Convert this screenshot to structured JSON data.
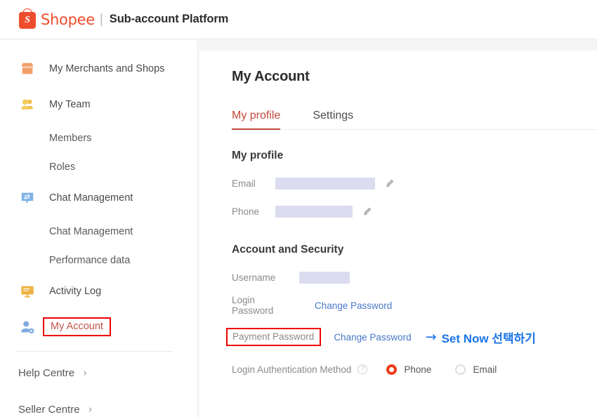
{
  "header": {
    "brand": "Shopee",
    "separator": "|",
    "title": "Sub-account Platform",
    "logo_letter": "S",
    "brand_color": "#ee4d2d"
  },
  "sidebar": {
    "items": [
      {
        "label": "My Merchants and Shops",
        "icon": "shop-icon",
        "type": "main"
      },
      {
        "label": "My Team",
        "icon": "people-icon",
        "type": "main"
      },
      {
        "label": "Members",
        "type": "sub"
      },
      {
        "label": "Roles",
        "type": "sub"
      },
      {
        "label": "Chat Management",
        "icon": "chat-icon",
        "type": "main"
      },
      {
        "label": "Chat Management",
        "type": "sub"
      },
      {
        "label": "Performance data",
        "type": "sub"
      },
      {
        "label": "Activity Log",
        "icon": "monitor-icon",
        "type": "main"
      },
      {
        "label": "My Account",
        "icon": "account-gear-icon",
        "type": "main",
        "active": true
      }
    ],
    "footer": [
      {
        "label": "Help Centre",
        "chevron": "›"
      },
      {
        "label": "Seller Centre",
        "chevron": "›"
      }
    ],
    "active_highlight_color": "#ee0000",
    "active_text_color": "#c1554a"
  },
  "main": {
    "page_title": "My Account",
    "tabs": [
      {
        "label": "My profile",
        "active": true
      },
      {
        "label": "Settings",
        "active": false
      }
    ],
    "profile_section": {
      "title": "My profile",
      "fields": [
        {
          "label": "Email",
          "value": "",
          "redacted": true,
          "editable": true
        },
        {
          "label": "Phone",
          "value": "",
          "redacted": true,
          "editable": true
        }
      ]
    },
    "security_section": {
      "title": "Account and Security",
      "username_label": "Username",
      "username_value": "",
      "login_password_label": "Login Password",
      "login_password_action": "Change Password",
      "payment_password_label": "Payment Password",
      "payment_password_action": "Change Password",
      "auth_label": "Login Authentication Method",
      "help_icon": "?",
      "auth_options": [
        {
          "label": "Phone",
          "selected": true
        },
        {
          "label": "Email",
          "selected": false
        }
      ]
    }
  },
  "annotations": {
    "payment_box_color": "#ee0000",
    "callout_color": "#1a73e8",
    "callout_arrow": "→",
    "callout_text": "Set Now 선택하기"
  }
}
